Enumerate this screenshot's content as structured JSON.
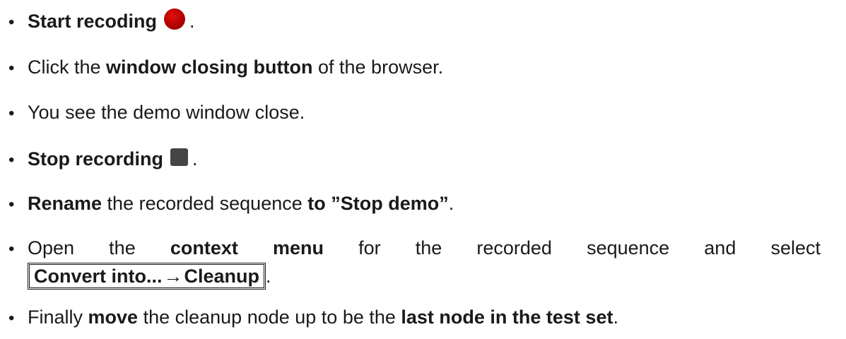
{
  "steps": [
    {
      "id": "start",
      "bullet": "•",
      "bold1": "Start recoding",
      "icon": "record-icon",
      "icon_color": "#b30000",
      "tail": "."
    },
    {
      "id": "close",
      "bullet": "•",
      "text1": "Click the ",
      "bold1": "window closing button",
      "text2": " of the browser."
    },
    {
      "id": "see",
      "bullet": "•",
      "text1": "You see the demo window close."
    },
    {
      "id": "stop",
      "bullet": "•",
      "bold1": "Stop recording",
      "icon": "stop-icon",
      "icon_color": "#454545",
      "tail": "."
    },
    {
      "id": "rename",
      "bullet": "•",
      "bold1": "Rename",
      "text1": " the recorded sequence ",
      "bold2": "to ”Stop demo”",
      "tail": "."
    },
    {
      "id": "convert",
      "bullet": "•",
      "words": [
        "Open",
        "the",
        "context",
        "menu",
        "for",
        "the",
        "recorded",
        "sequence",
        "and",
        "select"
      ],
      "menu_part1": "Convert into...",
      "menu_arrow": "→",
      "menu_part2": "Cleanup",
      "tail": "."
    },
    {
      "id": "move",
      "bullet": "•",
      "text1": "Finally ",
      "bold1": "move",
      "text2": " the cleanup node up to be the ",
      "bold2": "last node in the test set",
      "tail": "."
    }
  ]
}
